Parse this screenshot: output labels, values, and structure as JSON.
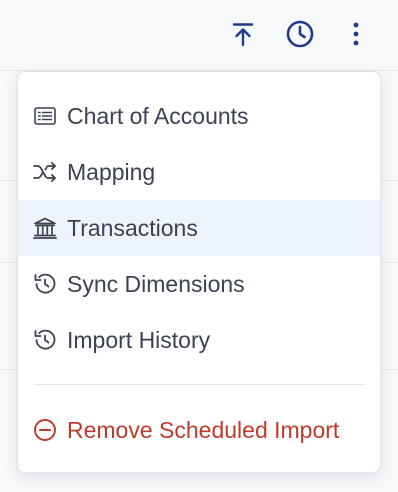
{
  "toolbar": {
    "icons": [
      "upload-icon",
      "clock-icon",
      "more-vertical-icon"
    ],
    "accent": "#1f3a8a"
  },
  "menu": {
    "items": [
      {
        "label": "Chart of Accounts",
        "icon": "list-icon"
      },
      {
        "label": "Mapping",
        "icon": "shuffle-icon"
      },
      {
        "label": "Transactions",
        "icon": "bank-icon",
        "active": true
      },
      {
        "label": "Sync Dimensions",
        "icon": "history-icon"
      },
      {
        "label": "Import History",
        "icon": "history-icon"
      }
    ],
    "danger_item": {
      "label": "Remove Scheduled Import",
      "icon": "minus-circle-icon"
    },
    "colors": {
      "text": "#3b4252",
      "active_bg": "#eef4fd",
      "danger": "#c0392b"
    }
  }
}
